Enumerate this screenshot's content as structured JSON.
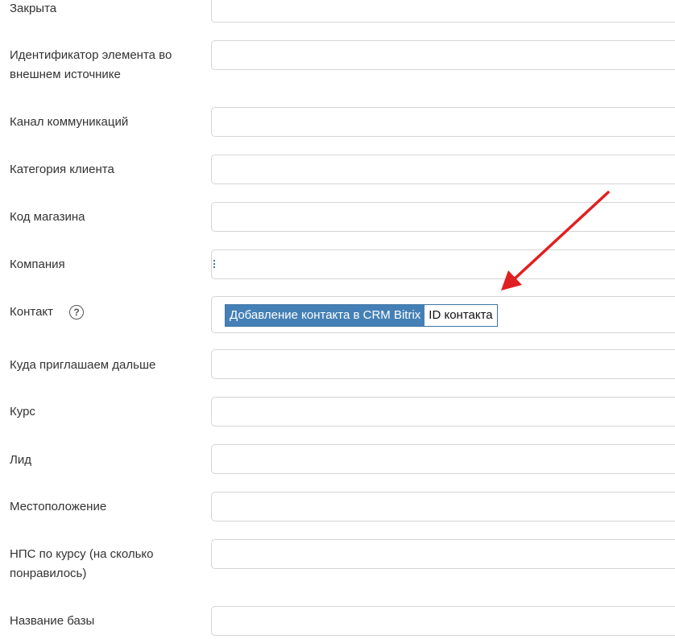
{
  "fields": [
    {
      "label": "Закрыта",
      "value": ""
    },
    {
      "label": "Идентификатор элемента во внешнем источнике",
      "value": ""
    },
    {
      "label": "Канал коммуникаций",
      "value": ""
    },
    {
      "label": "Категория клиента",
      "value": ""
    },
    {
      "label": "Код магазина",
      "value": ""
    },
    {
      "label": "Компания",
      "value": ""
    },
    {
      "label": "Контакт",
      "value": ""
    },
    {
      "label": "Куда приглашаем дальше",
      "value": ""
    },
    {
      "label": "Курс",
      "value": ""
    },
    {
      "label": "Лид",
      "value": ""
    },
    {
      "label": "Местоположение",
      "value": ""
    },
    {
      "label": "НПС по курсу (на сколько понравилось)",
      "value": ""
    },
    {
      "label": "Название базы",
      "value": ""
    }
  ],
  "contact_token": {
    "source": "Добавление контакта в CRM Bitrix",
    "field": "ID контакта"
  },
  "help_icon": {
    "glyph": "?",
    "icon": "question-circle-icon"
  },
  "colors": {
    "token_source_bg": "#4480b6",
    "field_border": "#d5d5d5",
    "arrow": "#e02020"
  }
}
